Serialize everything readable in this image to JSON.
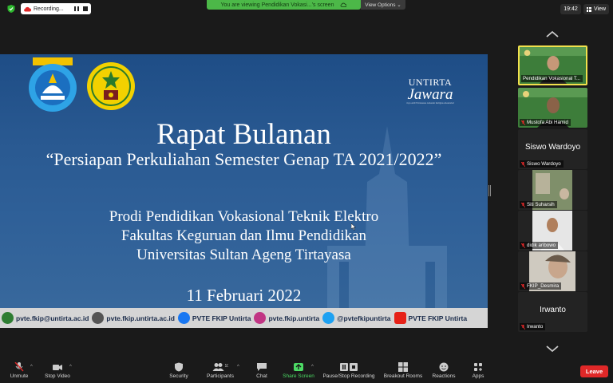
{
  "topbar": {
    "recording_label": "Recording...",
    "viewing_text": "You are viewing Pendidikan Vokasi...'s screen",
    "view_options_label": "View Options ⌄",
    "clock": "19:42",
    "view_label": "View"
  },
  "slide": {
    "logo_tut_text": "TUT WURI HANDAYANI",
    "logo_untirta_text": "UNIVERSITAS SULTAN AGENG TIRTAYASA",
    "brand_line1": "UNTIRTA",
    "brand_line2": "Jawara",
    "brand_line3": "Jaya Adil Wicaksana Amanah Religius Akuntabel",
    "title": "Rapat Bulanan",
    "subtitle": "“Persiapan Perkuliahan Semester Genap TA 2021/2022”",
    "line1": "Prodi Pendidikan Vokasional Teknik Elektro",
    "line2": "Fakultas Keguruan dan Ilmu Pendidikan",
    "line3": "Universitas Sultan Ageng Tirtayasa",
    "date": "11 Februari 2022",
    "contacts": [
      {
        "icon": "email-icon",
        "text": "pvte.fkip@untirta.ac.id",
        "color": "#2e7d32"
      },
      {
        "icon": "web-icon",
        "text": "pvte.fkip.untirta.ac.id",
        "color": "#555555"
      },
      {
        "icon": "facebook-icon",
        "text": "PVTE FKIP Untirta",
        "color": "#1877f2"
      },
      {
        "icon": "instagram-icon",
        "text": "pvte.fkip.untirta",
        "color": "#c13584"
      },
      {
        "icon": "twitter-icon",
        "text": "@pvtefkipuntirta",
        "color": "#1da1f2"
      },
      {
        "icon": "youtube-icon",
        "text": "PVTE FKIP Untirta",
        "color": "#e62117"
      }
    ]
  },
  "participants": [
    {
      "name": "Pendidikan Vokasional T...",
      "type": "video",
      "active": true
    },
    {
      "name": "Mustofa Abi Hamid",
      "type": "video",
      "active": false
    },
    {
      "name": "Siswo Wardoyo",
      "type": "name",
      "big": "Siswo Wardoyo",
      "active": false
    },
    {
      "name": "Siti Suharsih",
      "type": "video",
      "active": false
    },
    {
      "name": "didik aribowo",
      "type": "video",
      "active": false
    },
    {
      "name": "FKIP_Desmira",
      "type": "video",
      "active": false
    },
    {
      "name": "Irwanto",
      "type": "name",
      "big": "Irwanto",
      "active": false
    }
  ],
  "toolbar": {
    "unmute": "Unmute",
    "stop_video": "Stop Video",
    "security": "Security",
    "participants": "Participants",
    "participants_count": "10",
    "chat": "Chat",
    "share_screen": "Share Screen",
    "pause_recording": "Pause/Stop Recording",
    "breakout_rooms": "Breakout Rooms",
    "reactions": "Reactions",
    "apps": "Apps",
    "leave": "Leave"
  },
  "colors": {
    "accent_green": "#4cb848",
    "active_border": "#f2e14c",
    "leave_red": "#e02828",
    "slide_blue": "#2a5a92"
  }
}
